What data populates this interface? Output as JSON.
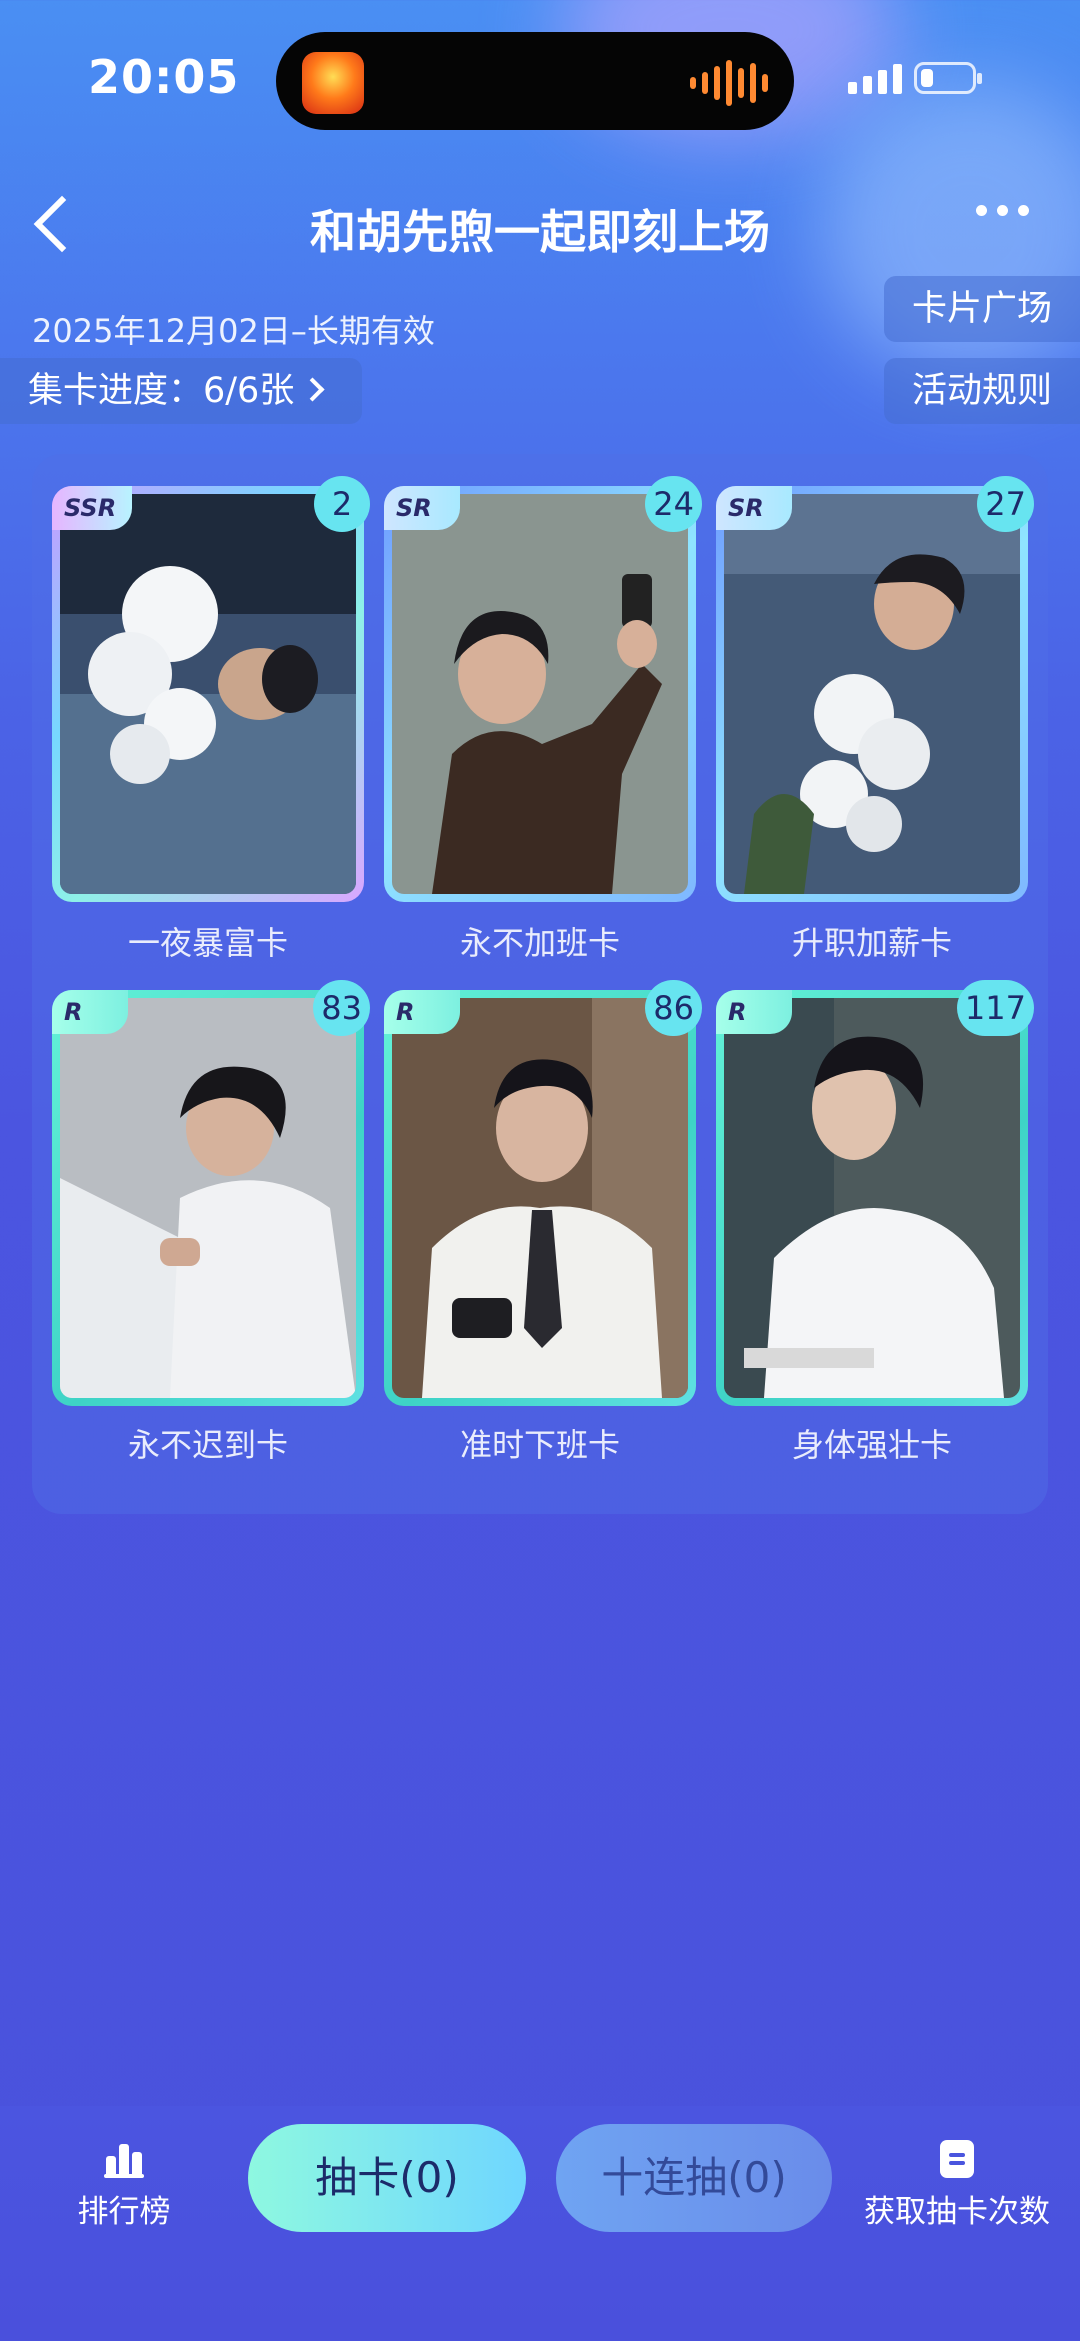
{
  "status": {
    "time": "20:05"
  },
  "header": {
    "title": "和胡先煦一起即刻上场"
  },
  "info": {
    "date": "2025年12月02日–长期有效",
    "progress_label": "集卡进度：6/6张",
    "card_plaza": "卡片广场",
    "rules": "活动规则"
  },
  "cards": [
    {
      "rarity": "SSR",
      "count": "2",
      "name": "一夜暴富卡"
    },
    {
      "rarity": "SR",
      "count": "24",
      "name": "永不加班卡"
    },
    {
      "rarity": "SR",
      "count": "27",
      "name": "升职加薪卡"
    },
    {
      "rarity": "R",
      "count": "83",
      "name": "永不迟到卡"
    },
    {
      "rarity": "R",
      "count": "86",
      "name": "准时下班卡"
    },
    {
      "rarity": "R",
      "count": "117",
      "name": "身体强壮卡"
    }
  ],
  "bottom": {
    "rank_label": "排行榜",
    "draw_label": "抽卡(0)",
    "ten_draw_label": "十连抽(0)",
    "get_draws_label": "获取抽卡次数"
  }
}
